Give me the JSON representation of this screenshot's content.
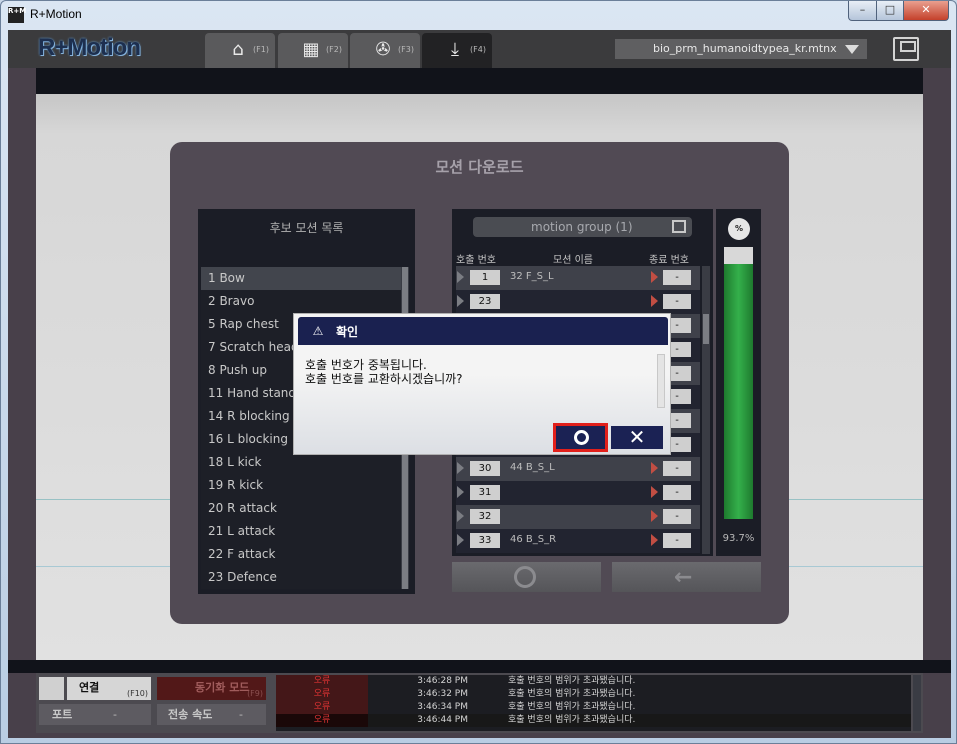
{
  "window": {
    "title": "R+Motion",
    "icon_text": "R+M",
    "min": "–",
    "max": "□",
    "close": "✕"
  },
  "app": {
    "logo": "R+Motion"
  },
  "tabs": [
    {
      "icon": "home-icon",
      "glyph": "⌂",
      "key": "(F1)",
      "active": false
    },
    {
      "icon": "film-icon",
      "glyph": "▦",
      "key": "(F2)",
      "active": false
    },
    {
      "icon": "reel-icon",
      "glyph": "✇",
      "key": "(F3)",
      "active": false
    },
    {
      "icon": "download-icon",
      "glyph": "⤓",
      "key": "(F4)",
      "active": true
    }
  ],
  "file": {
    "name": "bio_prm_humanoidtypea_kr.mtnx"
  },
  "panel": {
    "title": "모션 다운로드"
  },
  "candidates": {
    "title": "후보 모션 목록",
    "items": [
      "1 Bow",
      "2 Bravo",
      "5 Rap chest",
      "7 Scratch head",
      "8 Push up",
      "11 Hand standing",
      "14 R blocking",
      "16 L blocking",
      "18 L kick",
      "19 R kick",
      "20 R attack",
      "21 L attack",
      "22 F attack",
      "23 Defence"
    ],
    "selected_index": 0
  },
  "group": {
    "name": "motion group (1)",
    "col_call": "호출 번호",
    "col_name": "모션 이름",
    "col_end": "종료 번호",
    "rows": [
      {
        "num": "1",
        "name": "32 F_S_L",
        "end": "-"
      },
      {
        "num": "23",
        "name": "",
        "end": "-"
      },
      {
        "num": "",
        "name": "",
        "end": "-"
      },
      {
        "num": "",
        "name": "",
        "end": "-"
      },
      {
        "num": "",
        "name": "",
        "end": "-"
      },
      {
        "num": "",
        "name": "",
        "end": "-"
      },
      {
        "num": "",
        "name": "",
        "end": "-"
      },
      {
        "num": "",
        "name": "",
        "end": "-"
      },
      {
        "num": "30",
        "name": "44 B_S_L",
        "end": "-"
      },
      {
        "num": "31",
        "name": "",
        "end": "-"
      },
      {
        "num": "32",
        "name": "",
        "end": "-"
      },
      {
        "num": "33",
        "name": "46 B_S_R",
        "end": "-"
      }
    ]
  },
  "meter": {
    "icon_text": "%",
    "percent": 93.7,
    "label": "93.7%"
  },
  "modal": {
    "title": "확인",
    "line1": "호출 번호가 중복됩니다.",
    "line2": "호출 번호를 교환하시겠습니까?"
  },
  "bottom": {
    "connect": "연결",
    "connect_key": "(F10)",
    "sync": "동기화 모드",
    "sync_key": "(F9)",
    "port_label": "포트",
    "port_value": "-",
    "speed_label": "전송 속도",
    "speed_value": "-"
  },
  "log": [
    {
      "level": "오류",
      "time": "3:46:28 PM",
      "msg": "호출 번호의 범위가 초과됐습니다."
    },
    {
      "level": "오류",
      "time": "3:46:32 PM",
      "msg": "호출 번호의 범위가 초과됐습니다."
    },
    {
      "level": "오류",
      "time": "3:46:34 PM",
      "msg": "호출 번호의 범위가 초과됐습니다."
    },
    {
      "level": "오류",
      "time": "3:46:44 PM",
      "msg": "호출 번호의 범위가 초과됐습니다."
    }
  ],
  "colors": {
    "accent": "#1b2254",
    "highlight": "#e2201b",
    "meter": "#34b04b"
  }
}
